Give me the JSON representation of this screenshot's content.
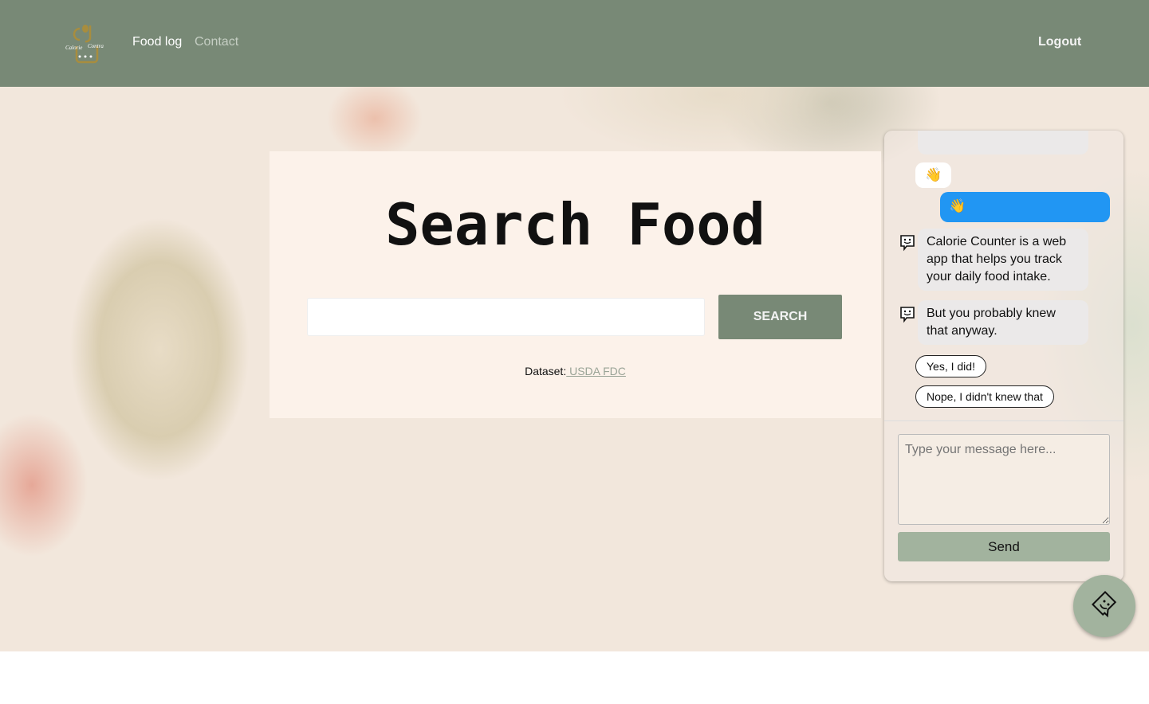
{
  "nav": {
    "logo_text": "Calorie Counter",
    "items": [
      {
        "label": "Food log",
        "active": true
      },
      {
        "label": "Contact",
        "active": false
      }
    ],
    "logout": "Logout"
  },
  "main": {
    "title": "Search Food",
    "search_value": "",
    "search_button": "SEARCH",
    "dataset_label": "Dataset:",
    "dataset_link": " USDA FDC"
  },
  "chat": {
    "messages": [
      {
        "from": "bot",
        "text": "👋"
      },
      {
        "from": "user",
        "text": "👋"
      },
      {
        "from": "bot",
        "text": "Calorie Counter is a web app that helps you track your daily food intake."
      },
      {
        "from": "bot",
        "text": "But you probably knew that anyway."
      }
    ],
    "options": [
      "Yes, I did!",
      "Nope, I didn't knew that"
    ],
    "placeholder": "Type your message here...",
    "send": "Send"
  },
  "colors": {
    "nav": "#788976",
    "accent": "#a2b39e",
    "user_bubble": "#2196f3"
  }
}
